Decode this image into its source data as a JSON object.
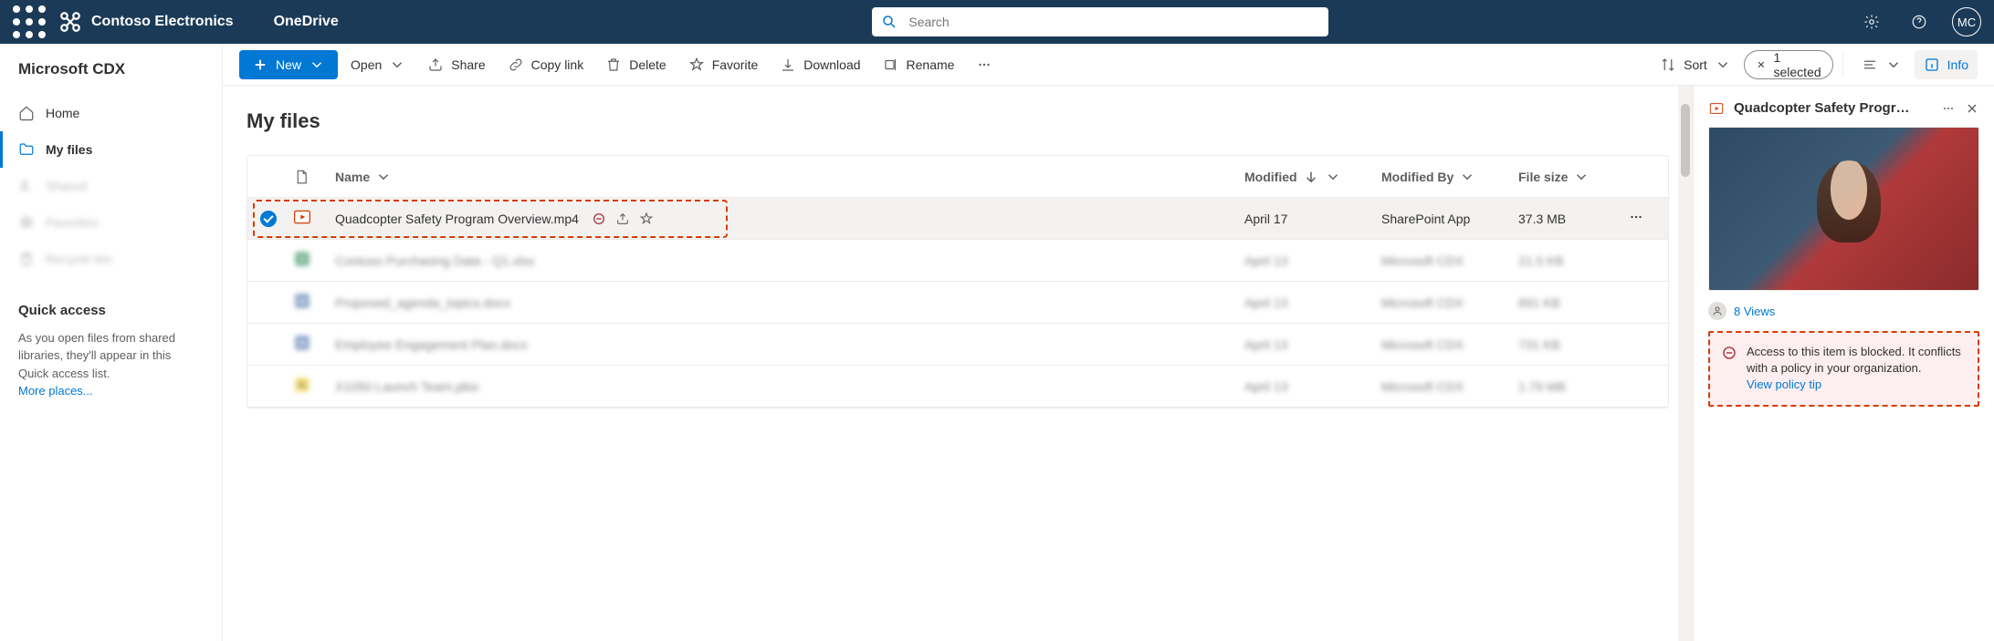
{
  "header": {
    "org": "Contoso Electronics",
    "app": "OneDrive",
    "search_placeholder": "Search",
    "avatar_initials": "MC"
  },
  "sidebar": {
    "title": "Microsoft CDX",
    "items": [
      {
        "label": "Home"
      },
      {
        "label": "My files"
      },
      {
        "label": "Shared"
      },
      {
        "label": "Favorites"
      },
      {
        "label": "Recycle bin"
      }
    ],
    "quick_access": {
      "heading": "Quick access",
      "body": "As you open files from shared libraries, they'll appear in this Quick access list.",
      "link": "More places..."
    }
  },
  "toolbar": {
    "new": "New",
    "open": "Open",
    "share": "Share",
    "copy_link": "Copy link",
    "delete": "Delete",
    "favorite": "Favorite",
    "download": "Download",
    "rename": "Rename",
    "sort": "Sort",
    "selected": "1 selected",
    "info": "Info"
  },
  "page": {
    "title": "My files"
  },
  "columns": {
    "name": "Name",
    "modified": "Modified",
    "modified_by": "Modified By",
    "file_size": "File size"
  },
  "files": [
    {
      "name": "Quadcopter Safety Program Overview.mp4",
      "modified": "April 17",
      "modified_by": "SharePoint App",
      "size": "37.3 MB",
      "selected": true,
      "type": "video"
    },
    {
      "name": "Contoso Purchasing Data - Q1.xlsx",
      "modified": "April 13",
      "modified_by": "Microsoft CDX",
      "size": "21.5 KB",
      "selected": false,
      "type": "xlsx"
    },
    {
      "name": "Proposed_agenda_topics.docx",
      "modified": "April 13",
      "modified_by": "Microsoft CDX",
      "size": "691 KB",
      "selected": false,
      "type": "docx"
    },
    {
      "name": "Employee Engagement Plan.docx",
      "modified": "April 13",
      "modified_by": "Microsoft CDX",
      "size": "731 KB",
      "selected": false,
      "type": "docx"
    },
    {
      "name": "X1050 Launch Team.pbix",
      "modified": "April 13",
      "modified_by": "Microsoft CDX",
      "size": "1.79 MB",
      "selected": false,
      "type": "pbix"
    }
  ],
  "details": {
    "title": "Quadcopter Safety Progr…",
    "views": "8 Views",
    "policy_text": "Access to this item is blocked. It conflicts with a policy in your organization.",
    "policy_link": "View policy tip"
  }
}
